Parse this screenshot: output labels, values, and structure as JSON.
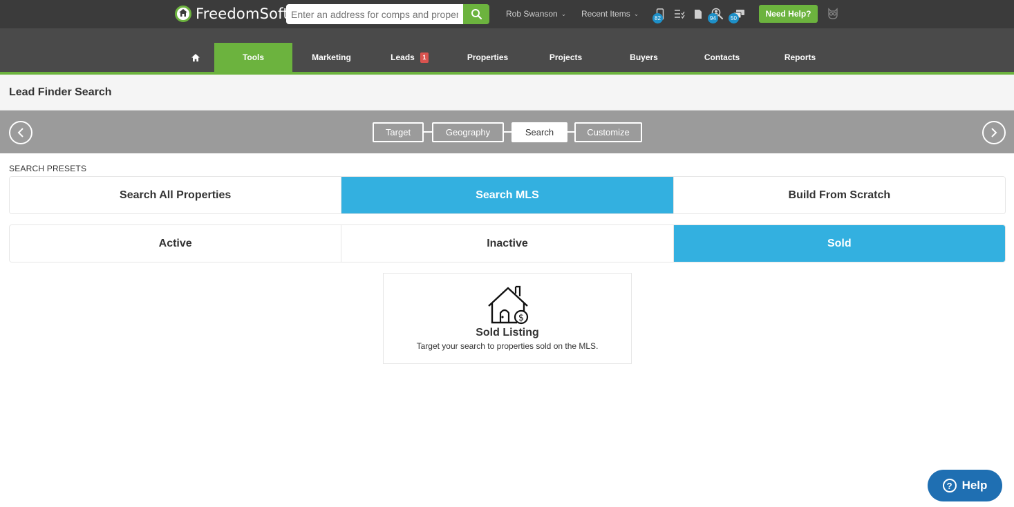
{
  "header": {
    "brand": "FreedomSoft",
    "search_placeholder": "Enter an address for comps and property details",
    "user_name": "Rob Swanson",
    "recent_items": "Recent Items",
    "need_help": "Need Help?",
    "icons": [
      {
        "name": "phone-icon",
        "badge": "82"
      },
      {
        "name": "task-list-icon",
        "badge": ""
      },
      {
        "name": "document-icon",
        "badge": ""
      },
      {
        "name": "person-search-icon",
        "badge": "94"
      },
      {
        "name": "chat-icon",
        "badge": "50"
      }
    ],
    "colors": {
      "bar": "#3b3b3b",
      "accent": "#6cb33e",
      "badge": "#1e90c8"
    }
  },
  "nav": {
    "items": [
      {
        "label": "Tools",
        "active": true
      },
      {
        "label": "Marketing"
      },
      {
        "label": "Leads",
        "badge": "1"
      },
      {
        "label": "Properties"
      },
      {
        "label": "Projects"
      },
      {
        "label": "Buyers"
      },
      {
        "label": "Contacts"
      },
      {
        "label": "Reports"
      }
    ]
  },
  "page": {
    "title": "Lead Finder Search"
  },
  "steps": {
    "items": [
      "Target",
      "Geography",
      "Search",
      "Customize"
    ],
    "active": "Search"
  },
  "presets": {
    "label": "SEARCH PRESETS",
    "row1": [
      "Search All Properties",
      "Search MLS",
      "Build From Scratch"
    ],
    "row1_active": "Search MLS",
    "row2": [
      "Active",
      "Inactive",
      "Sold"
    ],
    "row2_active": "Sold",
    "active_color": "#33b0e0"
  },
  "card": {
    "icon": "house-dollar-icon",
    "title": "Sold Listing",
    "description": "Target your search to properties sold on the MLS."
  },
  "help": {
    "label": "Help",
    "color": "#1f6fb2"
  }
}
